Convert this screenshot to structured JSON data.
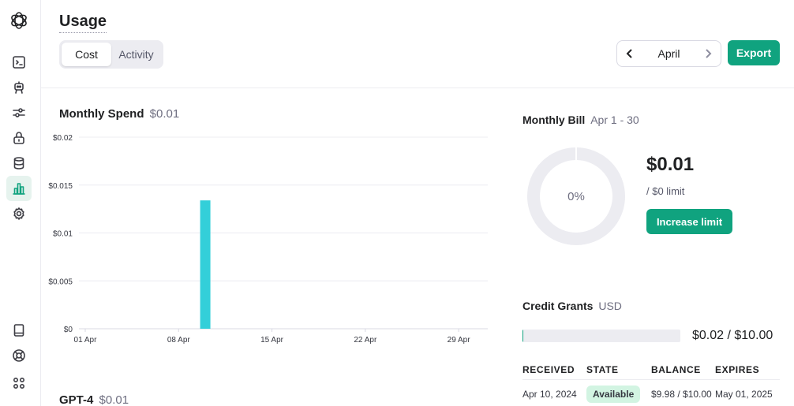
{
  "header": {
    "title": "Usage"
  },
  "tabs": [
    {
      "label": "Cost",
      "active": true
    },
    {
      "label": "Activity",
      "active": false
    }
  ],
  "month_nav": {
    "month": "April"
  },
  "export_label": "Export",
  "monthly_spend": {
    "title": "Monthly Spend",
    "amount": "$0.01"
  },
  "chart_data": {
    "type": "bar",
    "x_ticks": [
      "01 Apr",
      "08 Apr",
      "15 Apr",
      "22 Apr",
      "29 Apr"
    ],
    "y_ticks": [
      "$0",
      "$0.005",
      "$0.01",
      "$0.015",
      "$0.02"
    ],
    "ylim": [
      0,
      0.02
    ],
    "day_range": [
      1,
      30
    ],
    "bars": [
      {
        "day": 10,
        "value": 0.0134
      }
    ],
    "color": "#33cfd9",
    "grid": true
  },
  "gpt4": {
    "title": "GPT-4",
    "amount": "$0.01"
  },
  "monthly_bill": {
    "title": "Monthly Bill",
    "range": "Apr 1 - 30",
    "percent": "0%",
    "amount": "$0.01",
    "limit": "/ $0 limit",
    "button": "Increase limit"
  },
  "credit_grants": {
    "title": "Credit Grants",
    "unit": "USD",
    "used_fraction": 0.002,
    "value": "$0.02 / $10.00",
    "columns": [
      "RECEIVED",
      "STATE",
      "BALANCE",
      "EXPIRES"
    ],
    "rows": [
      {
        "received": "Apr 10, 2024",
        "state": "Available",
        "balance": "$9.98 / $10.00",
        "expires": "May 01, 2025"
      }
    ]
  },
  "colors": {
    "accent": "#10a37f",
    "bar": "#33cfd9",
    "donut_track": "#ececf1"
  },
  "sidebar": {
    "icons": [
      "openai-logo-icon",
      "terminal-icon",
      "robot-icon",
      "sliders-icon",
      "lock-icon",
      "database-icon",
      "bar-chart-icon",
      "gear-icon",
      "book-icon",
      "lifebuoy-icon",
      "apps-grid-icon"
    ]
  }
}
